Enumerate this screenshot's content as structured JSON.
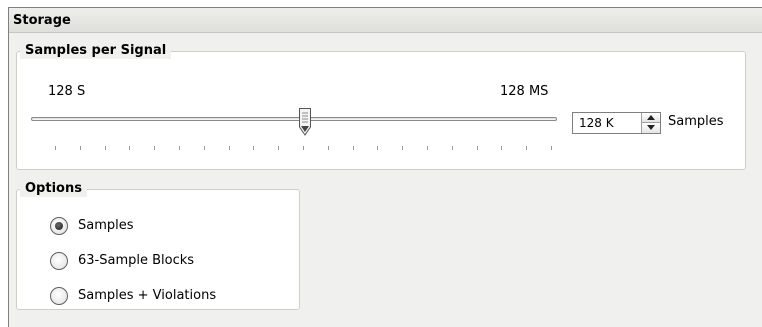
{
  "panel": {
    "title": "Storage"
  },
  "samples_per_signal": {
    "legend": "Samples per Signal",
    "min_label": "128 S",
    "max_label": "128 MS",
    "slider_position_fraction": 0.5,
    "spinner_value": "128 K",
    "unit_label": "Samples"
  },
  "options": {
    "legend": "Options",
    "items": [
      {
        "label": "Samples",
        "selected": true
      },
      {
        "label": "63-Sample Blocks",
        "selected": false
      },
      {
        "label": "Samples + Violations",
        "selected": false
      }
    ]
  },
  "icons": {
    "slider_thumb": "slider-thumb-icon",
    "spin_up": "arrow-up-icon",
    "spin_down": "arrow-down-icon",
    "radio": "radio-icon"
  }
}
